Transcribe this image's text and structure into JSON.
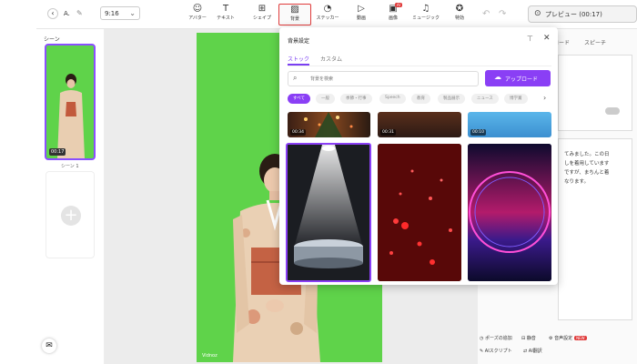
{
  "topbar": {
    "back_icon": "chevron-left-icon",
    "project_name": "A.",
    "ratio": "9:16",
    "tools": [
      {
        "label": "アバター",
        "icon": "avatar-icon"
      },
      {
        "label": "テキスト",
        "icon": "text-icon"
      },
      {
        "label": "シェイプ",
        "icon": "shape-icon"
      },
      {
        "label": "背景",
        "icon": "background-icon"
      },
      {
        "label": "ステッカー",
        "icon": "sticker-icon"
      },
      {
        "label": "動画",
        "icon": "video-icon"
      },
      {
        "label": "画像",
        "icon": "image-icon",
        "badge": "AI"
      },
      {
        "label": "ミュージック",
        "icon": "music-icon"
      },
      {
        "label": "特効",
        "icon": "effects-icon"
      }
    ],
    "preview": "プレビュー (00:17)"
  },
  "scene_panel": {
    "title": "シーン",
    "scene_time": "00:17",
    "scene_label": "シーン 1"
  },
  "canvas": {
    "watermark": "Vidnoz"
  },
  "right_panel": {
    "tab1": "ロード",
    "tab2": "スピーチ",
    "text_lines": [
      "てみました。この日",
      "しを着用しています",
      "ですが、まちんと着",
      "なります。"
    ],
    "tools": [
      {
        "label": "ポーズの追加"
      },
      {
        "label": "静音"
      },
      {
        "label": "音声設定",
        "badge": "NEW"
      },
      {
        "label": "AIスクリプト"
      },
      {
        "label": "AI翻訳"
      }
    ]
  },
  "bg_popup": {
    "title": "背景設定",
    "tabs": [
      "ストック",
      "カスタム"
    ],
    "active_tab": 0,
    "search_placeholder": "背景を検索",
    "upload_label": "アップロード",
    "categories": [
      "すべて",
      "一般",
      "季節・行事",
      "Speech",
      "教育",
      "製品展示",
      "ニュース",
      "博学賞"
    ],
    "active_category": 0,
    "top_row_durations": [
      "00:34",
      "00:31",
      "00:10"
    ],
    "tiles": [
      {
        "name": "spotlight-stage",
        "selected": true
      },
      {
        "name": "red-bokeh",
        "selected": false
      },
      {
        "name": "neon-circle",
        "selected": false
      }
    ]
  },
  "colors": {
    "accent": "#8a3ff5",
    "green_screen": "#5fd34a",
    "highlight": "#e03b3b"
  }
}
